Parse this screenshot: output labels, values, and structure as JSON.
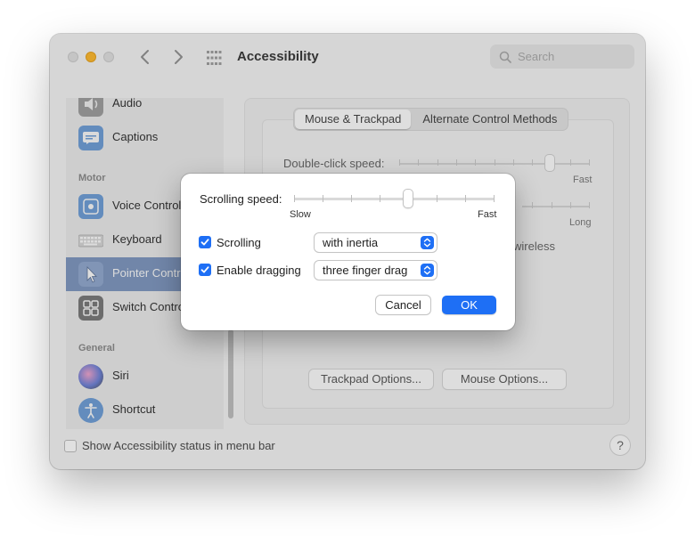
{
  "window": {
    "title": "Accessibility",
    "search_placeholder": "Search"
  },
  "sidebar": {
    "items": [
      {
        "label": "Audio",
        "icon": "speaker-icon"
      },
      {
        "label": "Captions",
        "icon": "captions-icon"
      },
      {
        "label": "Voice Control",
        "icon": "voice-control-icon"
      },
      {
        "label": "Keyboard",
        "icon": "keyboard-icon"
      },
      {
        "label": "Pointer Control",
        "icon": "pointer-icon"
      },
      {
        "label": "Switch Control",
        "icon": "switch-control-icon"
      },
      {
        "label": "Siri",
        "icon": "siri-icon"
      },
      {
        "label": "Shortcut",
        "icon": "accessibility-shortcut-icon"
      }
    ],
    "sections": {
      "motor": "Motor",
      "general": "General"
    },
    "selected": "Pointer Control"
  },
  "main": {
    "tabs": [
      "Mouse & Trackpad",
      "Alternate Control Methods"
    ],
    "active_tab": "Mouse & Trackpad",
    "double_click_label": "Double-click speed:",
    "fast_label": "Fast",
    "long_label": "Long",
    "wireless_fragment": "wireless",
    "trackpad_options": "Trackpad Options...",
    "mouse_options": "Mouse Options..."
  },
  "footer": {
    "status_label": "Show Accessibility status in menu bar",
    "status_checked": false,
    "help": "?"
  },
  "dialog": {
    "scrolling_speed_label": "Scrolling speed:",
    "scrolling_speed_value": 0.58,
    "slow_label": "Slow",
    "fast_label": "Fast",
    "scrolling": {
      "label": "Scrolling",
      "checked": true,
      "value": "with inertia"
    },
    "dragging": {
      "label": "Enable dragging",
      "checked": true,
      "value": "three finger drag"
    },
    "cancel": "Cancel",
    "ok": "OK"
  },
  "colors": {
    "accent": "#1e6ff5",
    "selection": "#7d94ba"
  }
}
